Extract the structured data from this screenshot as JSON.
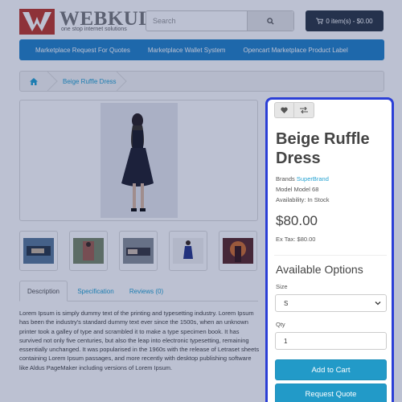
{
  "header": {
    "logo_word": "WEBKUL",
    "logo_tagline": "one stop internet solutions",
    "search_placeholder": "Search",
    "cart_label": "0 item(s) - $0.00"
  },
  "menu": {
    "items": [
      "Marketplace Request For Quotes",
      "Marketplace Wallet System",
      "Opencart Marketplace Product Label"
    ]
  },
  "breadcrumb": {
    "current": "Beige Ruffle Dress"
  },
  "tabs": {
    "description": "Description",
    "specification": "Specification",
    "reviews": "Reviews (0)"
  },
  "description_text": "Lorem Ipsum is simply dummy text of the printing and typesetting industry. Lorem Ipsum has been the industry's standard dummy text ever since the 1500s, when an unknown printer took a galley of type and scrambled it to make a type specimen book. It has survived not only five centuries, but also the leap into electronic typesetting, remaining essentially unchanged. It was popularised in the 1960s with the release of Letraset sheets containing Lorem Ipsum passages, and more recently with desktop publishing software like Aldus PageMaker including versions of Lorem Ipsum.",
  "product": {
    "title": "Beige Ruffle Dress",
    "brand_label": "Brands",
    "brand_value": "SuperBrand",
    "model": "Model Model 68",
    "availability": "Availability: In Stock",
    "price": "$80.00",
    "ex_tax": "Ex Tax: $80.00",
    "options_title": "Available Options",
    "size_label": "Size",
    "size_value": "S",
    "qty_label": "Qty",
    "qty_value": "1",
    "add_to_cart": "Add to Cart",
    "request_quote": "Request Quote"
  },
  "icons": {
    "wishlist": "heart-icon",
    "compare": "compare-arrows-icon",
    "home": "home-icon",
    "search": "search-icon",
    "cart": "cart-icon"
  },
  "colors": {
    "menu": "#2584c9",
    "cart_button": "#2e3a47",
    "primary_button": "#229ac8",
    "link": "#23a1d1",
    "highlight": "#2b3fd6"
  }
}
